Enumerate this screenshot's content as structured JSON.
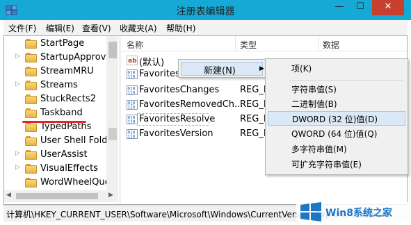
{
  "window": {
    "title": "注册表编辑器",
    "minimize": "—",
    "maximize": "☐",
    "close": "✕",
    "app_icon": "regedit-icon",
    "accent": "#17a9d6",
    "close_color": "#c7402f"
  },
  "menubar": [
    "文件(F)",
    "编辑(E)",
    "查看(V)",
    "收藏夹(A)",
    "帮助(H)"
  ],
  "tree": {
    "items": [
      {
        "label": "StartPage",
        "expandable": false
      },
      {
        "label": "StartupApprove",
        "expandable": true
      },
      {
        "label": "StreamMRU",
        "expandable": false
      },
      {
        "label": "Streams",
        "expandable": true
      },
      {
        "label": "StuckRects2",
        "expandable": false
      },
      {
        "label": "Taskband",
        "expandable": false,
        "selected": true
      },
      {
        "label": "TypedPaths",
        "expandable": false
      },
      {
        "label": "User Shell Folde",
        "expandable": false
      },
      {
        "label": "UserAssist",
        "expandable": true
      },
      {
        "label": "VisualEffects",
        "expandable": true
      },
      {
        "label": "WordWheelQue",
        "expandable": false
      }
    ],
    "highlight_color": "#e0242b"
  },
  "list": {
    "columns": [
      "名称",
      "类型",
      "数据"
    ],
    "rows": [
      {
        "name": "(默认)",
        "type": "",
        "icon": "string-value-icon"
      },
      {
        "name": "Favorites",
        "type": "",
        "icon": "binary-value-icon"
      },
      {
        "name": "FavoritesChanges",
        "type": "REG_D",
        "icon": "binary-value-icon"
      },
      {
        "name": "FavoritesRemovedCh...",
        "type": "REG_D",
        "icon": "binary-value-icon"
      },
      {
        "name": "FavoritesResolve",
        "type": "REG_B",
        "icon": "binary-value-icon"
      },
      {
        "name": "FavoritesVersion",
        "type": "REG_D",
        "icon": "binary-value-icon"
      }
    ]
  },
  "context_menu": {
    "new_label": "新建(N)",
    "submenu": {
      "key": "项(K)",
      "items": [
        "字符串值(S)",
        "二进制值(B)",
        "DWORD (32 位)值(D)",
        "QWORD (64 位)值(Q)",
        "多字符串值(M)",
        "可扩充字符串值(E)"
      ],
      "highlighted_index": 2
    }
  },
  "statusbar": {
    "path": "计算机\\HKEY_CURRENT_USER\\Software\\Microsoft\\Windows\\CurrentVersion\\Explorer\\Taskband"
  },
  "watermark": {
    "text": "Win8系统之家"
  }
}
